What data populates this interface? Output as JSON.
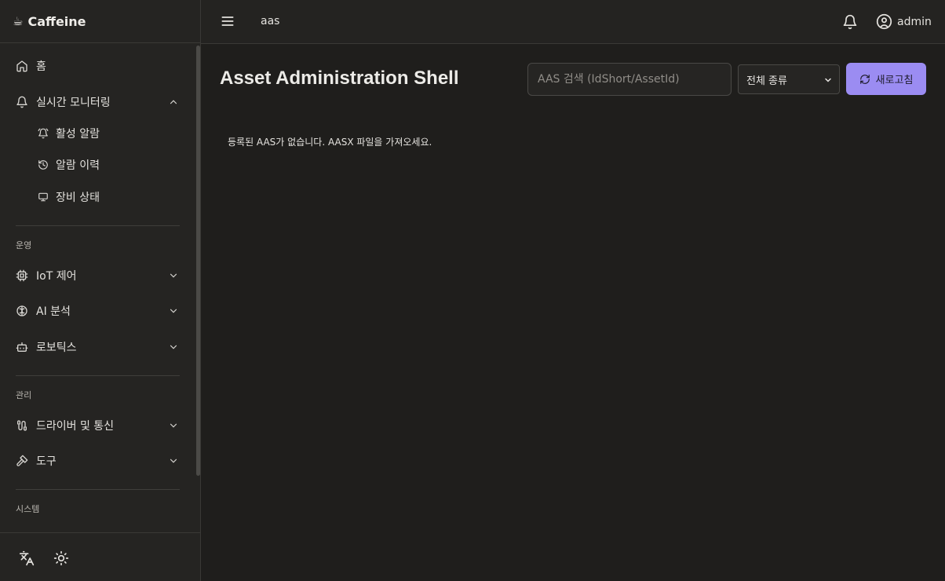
{
  "app": {
    "name": "Caffeine",
    "logo_icon": "coffee-cup-icon"
  },
  "sidebar": {
    "home": "홈",
    "monitoring": {
      "label": "실시간 모니터링",
      "children": [
        "활성 알람",
        "알람 이력",
        "장비 상태"
      ]
    },
    "sections": {
      "operations": "운영",
      "management": "관리",
      "system": "시스템"
    },
    "operations_items": [
      "IoT 제어",
      "AI 분석",
      "로보틱스"
    ],
    "management_items": [
      "드라이버 및 통신",
      "도구"
    ]
  },
  "topbar": {
    "breadcrumb": "aas",
    "user": "admin"
  },
  "main": {
    "title": "Asset Administration Shell",
    "search_placeholder": "AAS 검색 (IdShort/AssetId)",
    "filter_selected": "전체 종류",
    "refresh_label": "새로고침",
    "empty_message": "등록된 AAS가 없습니다. AASX 파일을 가져오세요."
  },
  "colors": {
    "background": "#1f1e1c",
    "sidebar": "#252422",
    "accent": "#9b8cf2"
  }
}
